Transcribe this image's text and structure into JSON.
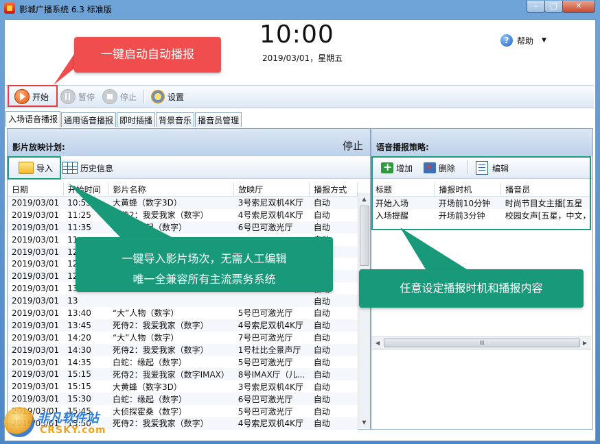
{
  "window": {
    "title": "影城广播系统 6.3 标准版",
    "min": "–",
    "max": "□",
    "close": "✕"
  },
  "clock": {
    "time": "10:00",
    "date": "2019/03/01，星期五"
  },
  "help": {
    "label": "帮助",
    "arrow": "▼"
  },
  "toolbar": {
    "start": "开始",
    "pause": "暂停",
    "stop": "停止",
    "settings": "设置"
  },
  "tabs": [
    "入场语音播报",
    "通用语音播报",
    "即时插播",
    "背景音乐",
    "播音员管理"
  ],
  "schedule": {
    "title": "影片放映计划:",
    "status": "停止",
    "import": "导入",
    "history": "历史信息",
    "columns": [
      "日期",
      "开始时间",
      "影片名称",
      "放映厅",
      "播报方式"
    ],
    "rows": [
      [
        "2019/03/01",
        "10:55",
        "大黄蜂（数字3D）",
        "3号索尼双机4K厅",
        "自动"
      ],
      [
        "2019/03/01",
        "11:25",
        "死侍2：我爱我家（数字）",
        "4号索尼双机4K厅",
        "自动"
      ],
      [
        "2019/03/01",
        "11:35",
        "白蛇：缘起（数字）",
        "6号巴可激光厅",
        "自动"
      ],
      [
        "2019/03/01",
        "11",
        "",
        "",
        "自动"
      ],
      [
        "2019/03/01",
        "12",
        "",
        "",
        "自动"
      ],
      [
        "2019/03/01",
        "12",
        "",
        "",
        "自动"
      ],
      [
        "2019/03/01",
        "12",
        "",
        "",
        "自动"
      ],
      [
        "2019/03/01",
        "13",
        "",
        "",
        "自动"
      ],
      [
        "2019/03/01",
        "13",
        "",
        "",
        "自动"
      ],
      [
        "2019/03/01",
        "13:40",
        "“大”人物（数字）",
        "5号巴可激光厅",
        "自动"
      ],
      [
        "2019/03/01",
        "13:45",
        "死侍2：我爱我家（数字）",
        "4号索尼双机4K厅",
        "自动"
      ],
      [
        "2019/03/01",
        "14:20",
        "“大”人物（数字）",
        "7号巴可激光厅",
        "自动"
      ],
      [
        "2019/03/01",
        "14:30",
        "死侍2：我爱我家（数字）",
        "1号杜比全景声厅",
        "自动"
      ],
      [
        "2019/03/01",
        "14:35",
        "白蛇：缘起（数字）",
        "5号巴可激光厅",
        "自动"
      ],
      [
        "2019/03/01",
        "15:15",
        "死侍2：我爱我家（数字IMAX）",
        "8号IMAX厅（儿...",
        "自动"
      ],
      [
        "2019/03/01",
        "15:15",
        "大黄蜂（数字3D）",
        "3号索尼双机4K厅",
        "自动"
      ],
      [
        "2019/03/01",
        "15:30",
        "白蛇：缘起（数字）",
        "6号巴可激光厅",
        "自动"
      ],
      [
        "2019/03/01",
        "15:45",
        "大侦探霍桑（数字）",
        "5号巴可激光厅",
        "自动"
      ],
      [
        "2019/03/01",
        "15:50",
        "死侍2：我爱我家（数字）",
        "4号索尼双机4K厅",
        "自动"
      ]
    ]
  },
  "strategy": {
    "title": "语音播报策略:",
    "add": "增加",
    "delete": "删除",
    "edit": "编辑",
    "columns": [
      "标题",
      "播报时机",
      "播音员"
    ],
    "rows": [
      [
        "开始入场",
        "开场前10分钟",
        "时尚节目女主播[五星"
      ],
      [
        "入场提醒",
        "开场前3分钟",
        "校园女声[五星，中文，"
      ]
    ],
    "hscroll_grip": "III"
  },
  "callouts": {
    "start": "一键启动自动播报",
    "import_line1": "一键导入影片场次，无需人工编辑",
    "import_line2": "唯一全兼容所有主流票务系统",
    "strategy": "任意设定播报时机和播报内容"
  },
  "watermark": {
    "cn": "非凡软件站",
    "en": "CRSKY.com"
  },
  "colors": {
    "red_callout": "#f04e4e",
    "teal_callout": "#189a7a",
    "highlight_red": "#e83c3c",
    "highlight_teal": "#1e9e7e"
  }
}
